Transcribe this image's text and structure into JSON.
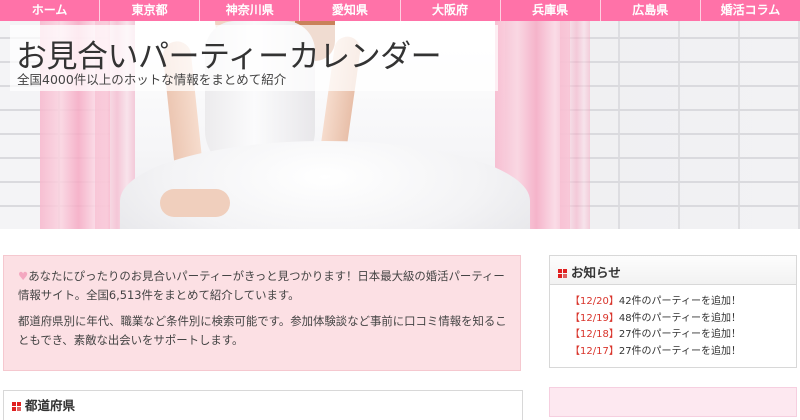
{
  "nav": {
    "items": [
      {
        "label": "ホーム"
      },
      {
        "label": "東京都"
      },
      {
        "label": "神奈川県"
      },
      {
        "label": "愛知県"
      },
      {
        "label": "大阪府"
      },
      {
        "label": "兵庫県"
      },
      {
        "label": "広島県"
      },
      {
        "label": "婚活コラム"
      }
    ]
  },
  "hero": {
    "title": "お見合いパーティーカレンダー",
    "subtitle": "全国4000件以上のホットな情報をまとめて紹介"
  },
  "intro": {
    "paragraph1": "あなたにぴったりのお見合いパーティーがきっと見つかります！日本最大級の婚活パーティー情報サイト。全国6,513件をまとめて紹介しています。",
    "paragraph2": "都道府県別に年代、職業など条件別に検索可能です。参加体験談など事前に口コミ情報を知ることもでき、素敵な出会いをサポートします。"
  },
  "prefectures": {
    "title": "都道府県"
  },
  "news": {
    "title": "お知らせ",
    "items": [
      {
        "date": "【12/20】",
        "text": "42件のパーティーを追加！"
      },
      {
        "date": "【12/19】",
        "text": "48件のパーティーを追加！"
      },
      {
        "date": "【12/18】",
        "text": "27件のパーティーを追加！"
      },
      {
        "date": "【12/17】",
        "text": "27件のパーティーを追加！"
      }
    ]
  },
  "colors": {
    "nav_bg": "#ff72a8",
    "intro_bg": "#fce0e4",
    "news_date": "#d9342b",
    "icon_red": "#e02020"
  }
}
